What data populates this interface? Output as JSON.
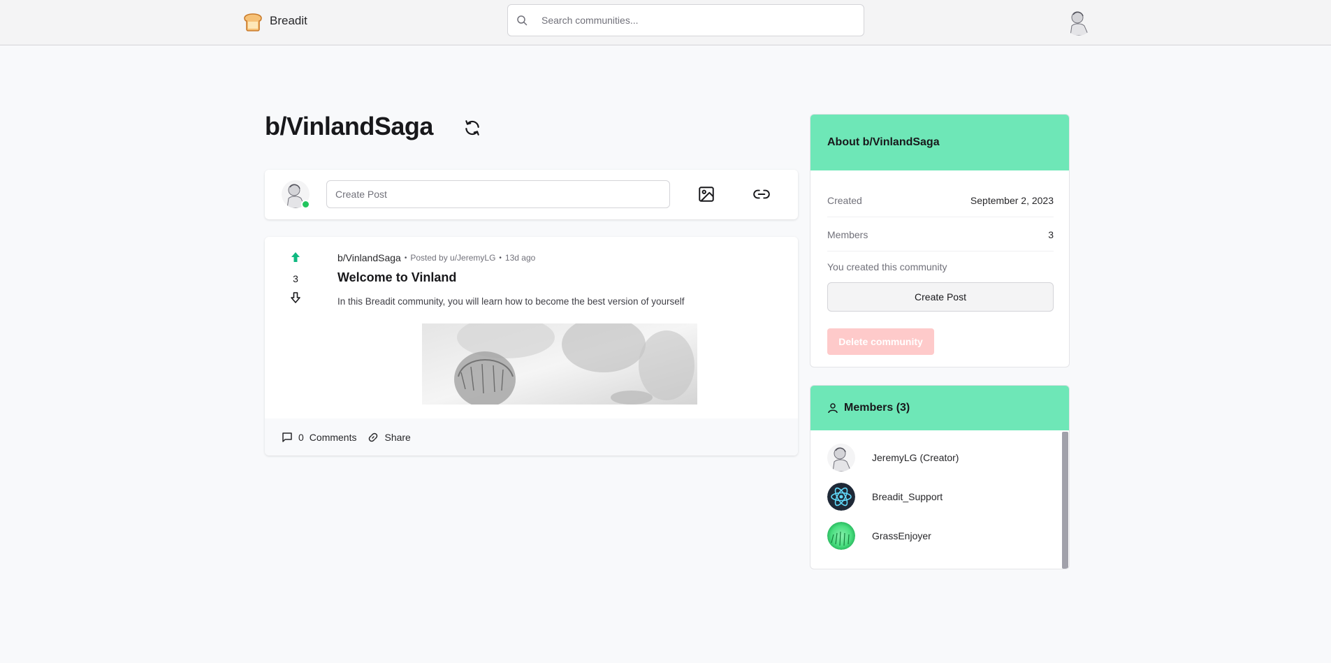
{
  "navbar": {
    "brand": "Breadit",
    "search_placeholder": "Search communities..."
  },
  "page": {
    "title": "b/VinlandSaga"
  },
  "create_post": {
    "placeholder": "Create Post"
  },
  "post": {
    "subreddit": "b/VinlandSaga",
    "posted_by": "Posted by u/JeremyLG",
    "time": "13d ago",
    "bullet": "•",
    "votes": "3",
    "title": "Welcome to Vinland",
    "body": "In this Breadit community, you will learn how to become the best version of yourself",
    "comments_count": "0",
    "comments_label": "Comments",
    "share_label": "Share"
  },
  "about": {
    "title": "About b/VinlandSaga",
    "rows": [
      {
        "key": "Created",
        "value": "September 2, 2023"
      },
      {
        "key": "Members",
        "value": "3"
      }
    ],
    "note": "You created this community",
    "create_post_label": "Create Post",
    "delete_label": "Delete community"
  },
  "members": {
    "title": "Members (3)",
    "list": [
      {
        "name": "JeremyLG (Creator)"
      },
      {
        "name": "Breadit_Support"
      },
      {
        "name": "GrassEnjoyer"
      }
    ]
  },
  "colors": {
    "accent_green": "#6ee7b7",
    "upvote_green": "#10b981",
    "online": "#22c55e",
    "danger_soft": "#fecaca"
  }
}
